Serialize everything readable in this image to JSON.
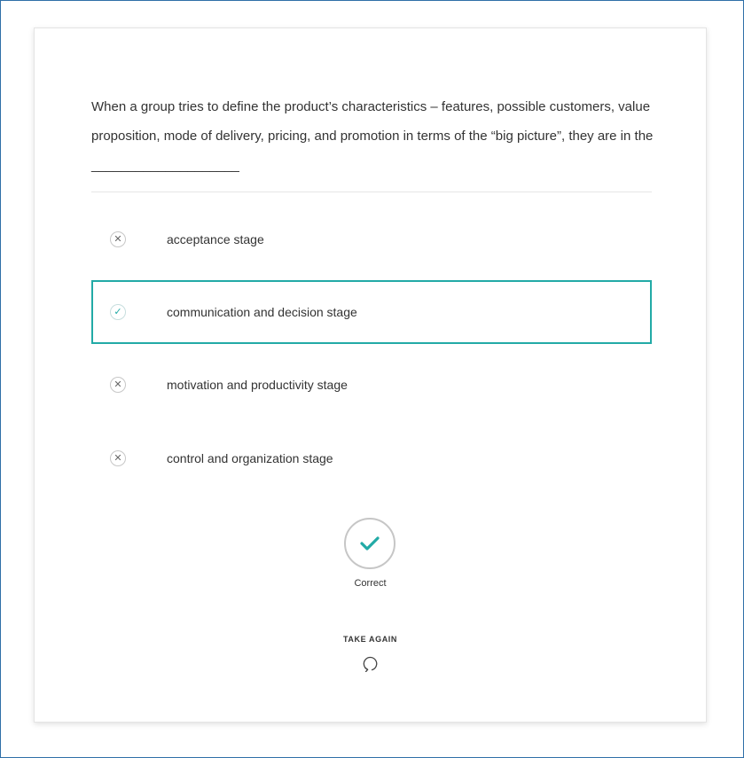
{
  "question": {
    "text": "When a group tries to define the product’s characteristics – features, possible customers, value proposition, mode of delivery, pricing, and promotion in terms of the “big picture”, they are in the ____________________"
  },
  "options": [
    {
      "label": "acceptance stage",
      "icon": "x-icon",
      "selected": false
    },
    {
      "label": "communication and decision stage",
      "icon": "check-icon",
      "selected": true
    },
    {
      "label": "motivation and productivity stage",
      "icon": "x-icon",
      "selected": false
    },
    {
      "label": "control and organization stage",
      "icon": "x-icon",
      "selected": false
    }
  ],
  "result": {
    "icon": "check-icon",
    "label": "Correct"
  },
  "take_again": {
    "label": "TAKE AGAIN",
    "icon": "retry-icon"
  },
  "colors": {
    "accent": "#22aaa6",
    "frame_border": "#2f6fa8",
    "text": "#333333"
  }
}
